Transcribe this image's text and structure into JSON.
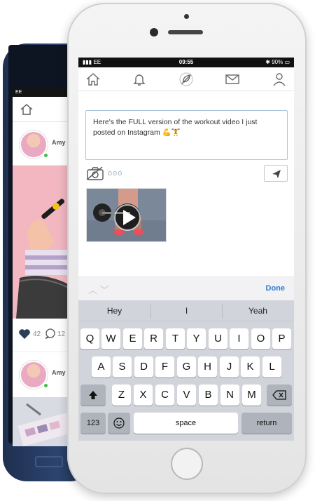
{
  "back_phone": {
    "username": "Amy",
    "likes_count": "42",
    "comments_count": "12",
    "username_2": "Amy"
  },
  "status_bar": {
    "carrier": "EE",
    "time": "09:55",
    "battery": "90%"
  },
  "composer": {
    "text": "Here's the FULL version of the workout video I just posted on Instagram 💪🏋"
  },
  "toolbar": {
    "dots": "ooo"
  },
  "accessory": {
    "done_label": "Done"
  },
  "keyboard": {
    "predictions": [
      "Hey",
      "I",
      "Yeah"
    ],
    "row1": [
      "Q",
      "W",
      "E",
      "R",
      "T",
      "Y",
      "U",
      "I",
      "O",
      "P"
    ],
    "row2": [
      "A",
      "S",
      "D",
      "F",
      "G",
      "H",
      "J",
      "K",
      "L"
    ],
    "row3": [
      "Z",
      "X",
      "C",
      "V",
      "B",
      "N",
      "M"
    ],
    "numbers_label": "123",
    "space_label": "space",
    "return_label": "return"
  },
  "colors": {
    "accent": "#2b7bd0",
    "online": "#3bbf4a"
  }
}
